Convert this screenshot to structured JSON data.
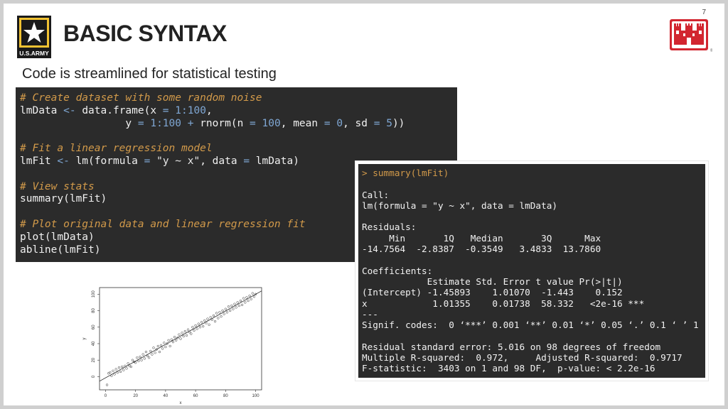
{
  "page_number": "7",
  "title": "BASIC SYNTAX",
  "subtitle": "Code is streamlined for statistical testing",
  "army_logo": {
    "text": "U.S.ARMY",
    "icon": "army-star-icon"
  },
  "castle_logo": {
    "icon": "usace-castle-icon",
    "mark": "®"
  },
  "code": {
    "comment1": "# Create dataset with some random noise",
    "line1": [
      "lmData",
      " <- ",
      "data.frame(",
      "x",
      " = ",
      "1:100",
      ","
    ],
    "line2": [
      "                 ",
      "y",
      " = ",
      "1:100",
      " + ",
      "rnorm(",
      "n",
      " = ",
      "100",
      ", ",
      "mean",
      " = ",
      "0",
      ", ",
      "sd",
      " = ",
      "5",
      "))"
    ],
    "comment2": "# Fit a linear regression model",
    "line3": [
      "lmFit",
      " <- ",
      "lm(",
      "formula",
      " = ",
      "\"y ~ x\"",
      ", ",
      "data",
      " = ",
      "lmData",
      ")"
    ],
    "comment3": "# View stats",
    "line4": "summary(lmFit)",
    "comment4": "# Plot original data and linear regression fit",
    "line5": "plot(lmData)",
    "line6": "abline(lmFit)"
  },
  "output": {
    "prompt": "> summary(lmFit)",
    "lines": [
      "",
      "Call:",
      "lm(formula = \"y ~ x\", data = lmData)",
      "",
      "Residuals:",
      "     Min       1Q   Median       3Q      Max ",
      "-14.7564  -2.8387  -0.3549   3.4833  13.7860 ",
      "",
      "Coefficients:",
      "            Estimate Std. Error t value Pr(>|t|)    ",
      "(Intercept) -1.45893    1.01070  -1.443    0.152    ",
      "x            1.01355    0.01738  58.332   <2e-16 ***",
      "---",
      "Signif. codes:  0 ‘***’ 0.001 ‘**’ 0.01 ‘*’ 0.05 ‘.’ 0.1 ‘ ’ 1",
      "",
      "Residual standard error: 5.016 on 98 degrees of freedom",
      "Multiple R-squared:  0.972,\tAdjusted R-squared:  0.9717 ",
      "F-statistic:  3403 on 1 and 98 DF,  p-value: < 2.2e-16"
    ]
  },
  "chart_data": {
    "type": "scatter",
    "xlabel": "x",
    "ylabel": "y",
    "x_ticks": [
      0,
      20,
      40,
      60,
      80,
      100
    ],
    "y_ticks": [
      0,
      20,
      40,
      60,
      80,
      100
    ],
    "xlim": [
      -4,
      104
    ],
    "ylim": [
      -16,
      108
    ],
    "regression_line": {
      "intercept": -1.45893,
      "slope": 1.01355
    },
    "points": [
      [
        1,
        -10
      ],
      [
        2,
        4
      ],
      [
        3,
        5
      ],
      [
        4,
        1
      ],
      [
        5,
        7
      ],
      [
        6,
        3
      ],
      [
        7,
        9
      ],
      [
        8,
        5
      ],
      [
        9,
        11
      ],
      [
        10,
        6
      ],
      [
        11,
        12
      ],
      [
        12,
        8
      ],
      [
        13,
        13
      ],
      [
        14,
        10
      ],
      [
        15,
        16
      ],
      [
        16,
        13
      ],
      [
        17,
        12
      ],
      [
        18,
        20
      ],
      [
        19,
        18
      ],
      [
        20,
        17
      ],
      [
        21,
        23
      ],
      [
        22,
        19
      ],
      [
        23,
        24
      ],
      [
        24,
        20
      ],
      [
        25,
        27
      ],
      [
        26,
        22
      ],
      [
        27,
        30
      ],
      [
        28,
        25
      ],
      [
        29,
        23
      ],
      [
        30,
        31
      ],
      [
        31,
        27
      ],
      [
        32,
        35
      ],
      [
        33,
        29
      ],
      [
        34,
        33
      ],
      [
        35,
        37
      ],
      [
        36,
        30
      ],
      [
        37,
        38
      ],
      [
        38,
        34
      ],
      [
        39,
        41
      ],
      [
        40,
        36
      ],
      [
        41,
        40
      ],
      [
        42,
        44
      ],
      [
        43,
        37
      ],
      [
        44,
        45
      ],
      [
        45,
        42
      ],
      [
        46,
        48
      ],
      [
        47,
        44
      ],
      [
        48,
        47
      ],
      [
        49,
        51
      ],
      [
        50,
        46
      ],
      [
        51,
        53
      ],
      [
        52,
        49
      ],
      [
        53,
        55
      ],
      [
        54,
        50
      ],
      [
        55,
        57
      ],
      [
        56,
        54
      ],
      [
        57,
        52
      ],
      [
        58,
        60
      ],
      [
        59,
        56
      ],
      [
        60,
        62
      ],
      [
        61,
        58
      ],
      [
        62,
        64
      ],
      [
        63,
        60
      ],
      [
        64,
        66
      ],
      [
        65,
        61
      ],
      [
        66,
        68
      ],
      [
        67,
        65
      ],
      [
        68,
        70
      ],
      [
        69,
        63
      ],
      [
        70,
        72
      ],
      [
        71,
        69
      ],
      [
        72,
        74
      ],
      [
        73,
        67
      ],
      [
        74,
        77
      ],
      [
        75,
        71
      ],
      [
        76,
        78
      ],
      [
        77,
        73
      ],
      [
        78,
        80
      ],
      [
        79,
        76
      ],
      [
        80,
        82
      ],
      [
        81,
        78
      ],
      [
        82,
        85
      ],
      [
        83,
        80
      ],
      [
        84,
        86
      ],
      [
        85,
        82
      ],
      [
        86,
        88
      ],
      [
        87,
        84
      ],
      [
        88,
        90
      ],
      [
        89,
        86
      ],
      [
        90,
        92
      ],
      [
        91,
        87
      ],
      [
        92,
        95
      ],
      [
        93,
        90
      ],
      [
        94,
        96
      ],
      [
        95,
        92
      ],
      [
        96,
        98
      ],
      [
        97,
        94
      ],
      [
        98,
        101
      ],
      [
        99,
        97
      ],
      [
        100,
        100
      ]
    ]
  }
}
